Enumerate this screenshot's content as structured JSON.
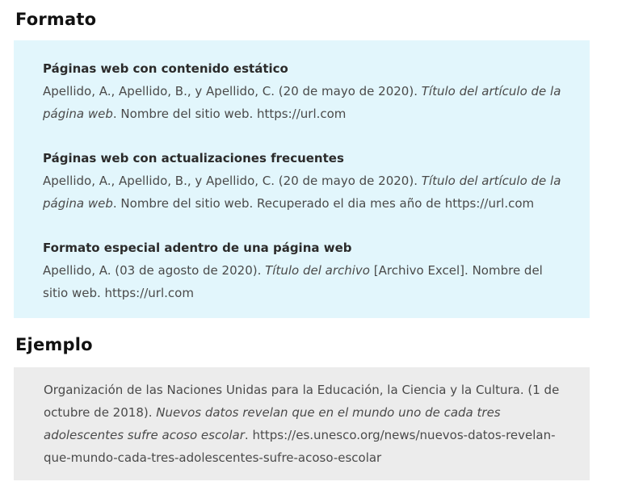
{
  "formato": {
    "heading": "Formato",
    "entries": [
      {
        "title": "Páginas web con contenido estático",
        "authors_date": "Apellido, A., Apellido, B., y Apellido, C. (20 de mayo de 2020). ",
        "work_title": "Título del artículo de la página web",
        "rest": ". Nombre del sitio web. https://url.com"
      },
      {
        "title": "Páginas web con actualizaciones frecuentes",
        "authors_date": "Apellido, A., Apellido, B., y Apellido, C. (20 de mayo de 2020). ",
        "work_title": "Título del artículo de la página web",
        "rest": ". Nombre del sitio web. Recuperado el dia mes año de https://url.com"
      },
      {
        "title": "Formato especial adentro de una página web",
        "authors_date": "Apellido, A. (03 de agosto de 2020). ",
        "work_title": "Título del archivo",
        "rest": " [Archivo Excel]. Nombre del sitio web. https://url.com"
      }
    ]
  },
  "ejemplo": {
    "heading": "Ejemplo",
    "authors_date": "Organización de las Naciones Unidas para la Educación, la Ciencia y la Cultura. (1 de octubre de 2018). ",
    "work_title": "Nuevos datos revelan que en el mundo uno de cada tres adolescentes sufre acoso escolar",
    "rest": ". https://es.unesco.org/news/nuevos-datos-revelan-que-mundo-cada-tres-adolescentes-sufre-acoso-escolar"
  },
  "colors": {
    "formato_box": "#e2f6fc",
    "ejemplo_box": "#ececec"
  }
}
